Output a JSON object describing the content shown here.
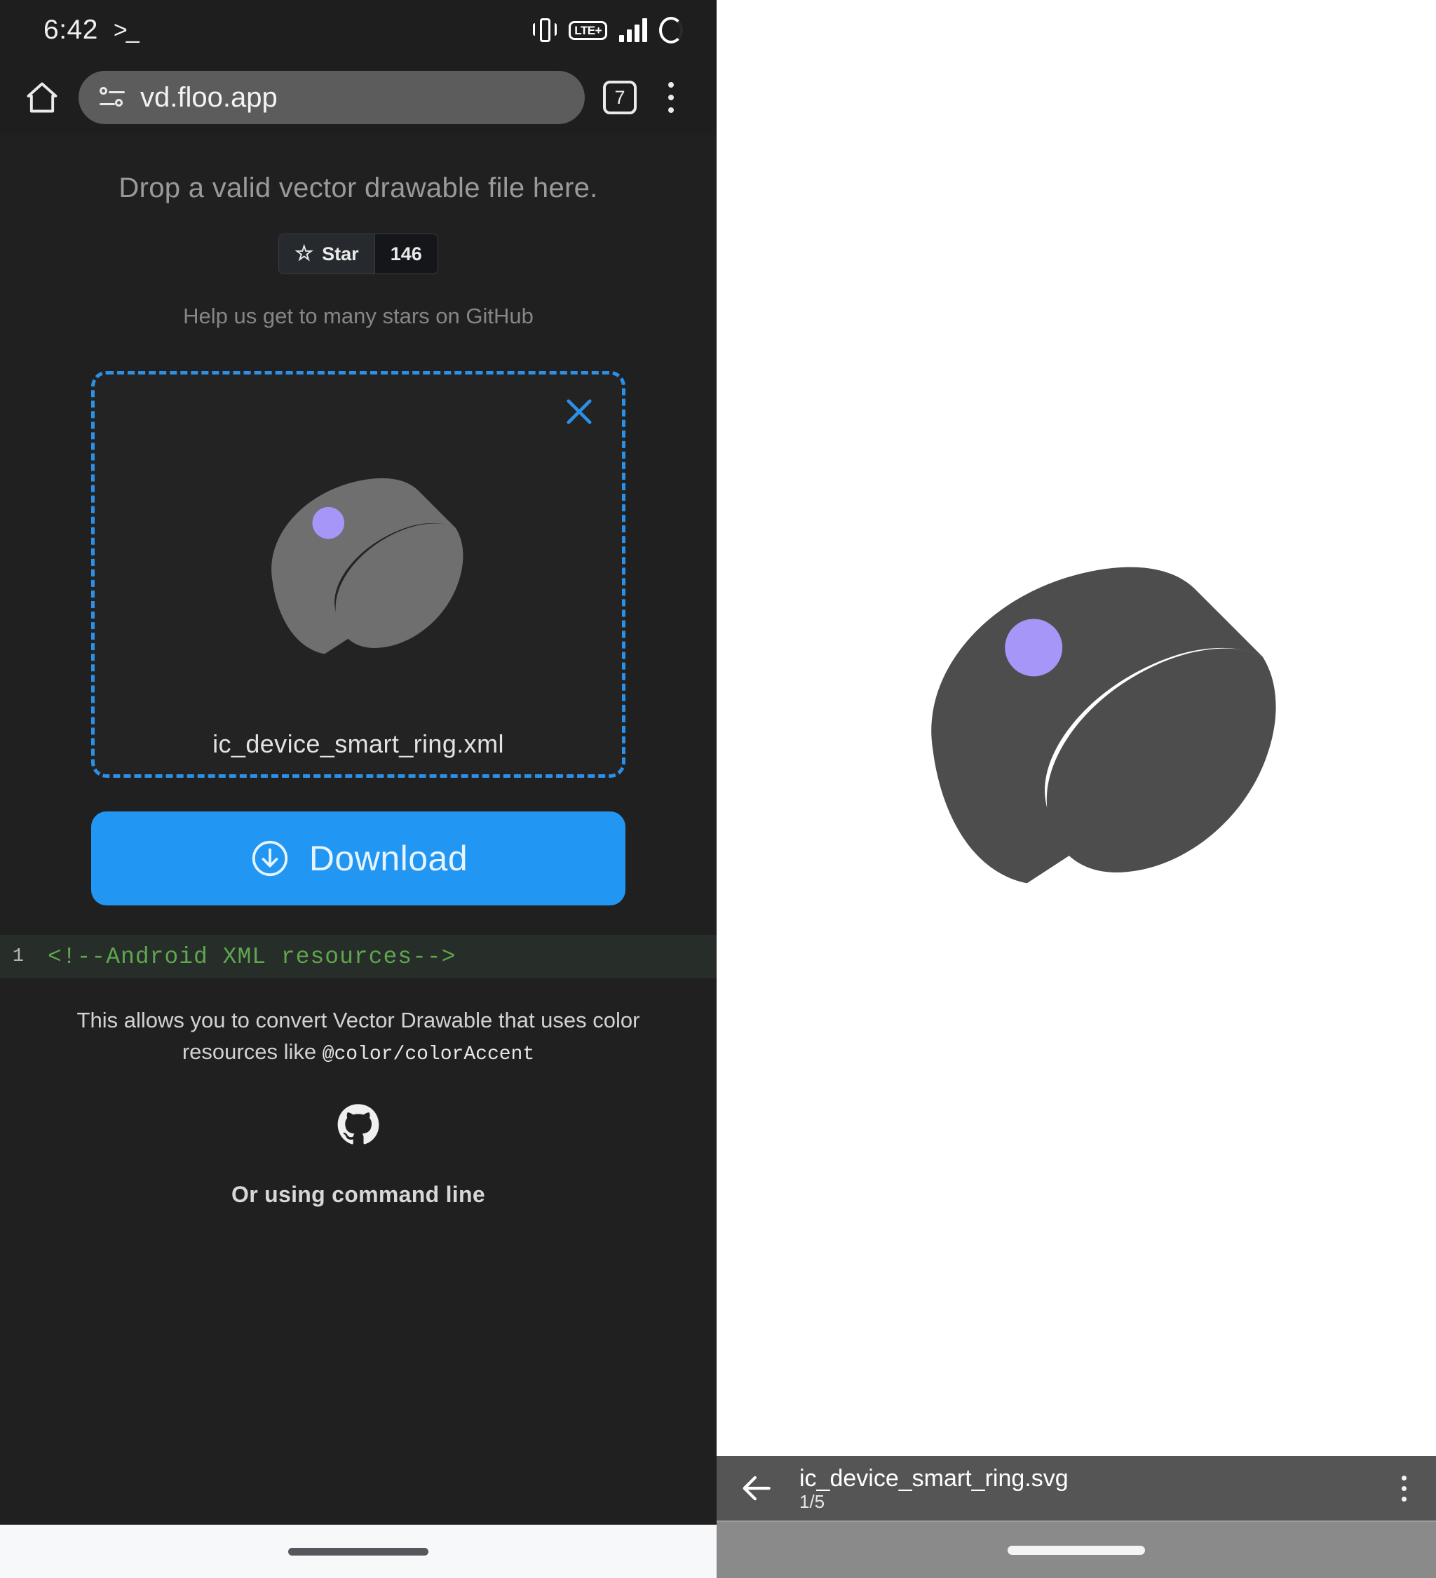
{
  "statusbar": {
    "time": "6:42",
    "prompt_glyph": ">_",
    "icons": [
      "vibrate-icon",
      "lte-badge",
      "signal-bars-icon",
      "battery-ring-icon"
    ],
    "lte_label": "LTE+"
  },
  "browser": {
    "home_icon": "home-icon",
    "site_settings_icon": "tune-icon",
    "url": "vd.floo.app",
    "tab_count": "7",
    "menu_icon": "kebab-menu-icon"
  },
  "page": {
    "drop_hint": "Drop a valid vector drawable file here.",
    "star_button": {
      "icon": "star-icon",
      "label": "Star",
      "count": "146"
    },
    "help_text": "Help us get to many stars on GitHub",
    "dropzone": {
      "close_icon": "close-icon",
      "preview_icon": "smart-ring-icon",
      "filename": "ic_device_smart_ring.xml"
    },
    "download_button": {
      "icon": "download-circle-icon",
      "label": "Download"
    },
    "code": {
      "line_number": "1",
      "text": "<!--Android XML resources-->"
    },
    "description_line1": "This allows you to convert Vector Drawable that uses color",
    "description_line2_prefix": "resources like ",
    "description_line2_code": "@color/colorAccent",
    "github_icon": "github-icon",
    "command_line_heading": "Or using command line"
  },
  "viewer": {
    "preview_icon": "smart-ring-icon",
    "back_icon": "back-arrow-icon",
    "title": "ic_device_smart_ring.svg",
    "subtitle": "1/5",
    "menu_icon": "kebab-menu-icon"
  },
  "colors": {
    "accent_blue": "#2196f3",
    "dashed_border": "#2b90e8",
    "ring_gray_dark": "#4d4d4d",
    "ring_gray_light": "#6f6f6f",
    "ring_dot_purple": "#a696f8",
    "code_green": "#5ea64f",
    "page_background": "#202020"
  }
}
